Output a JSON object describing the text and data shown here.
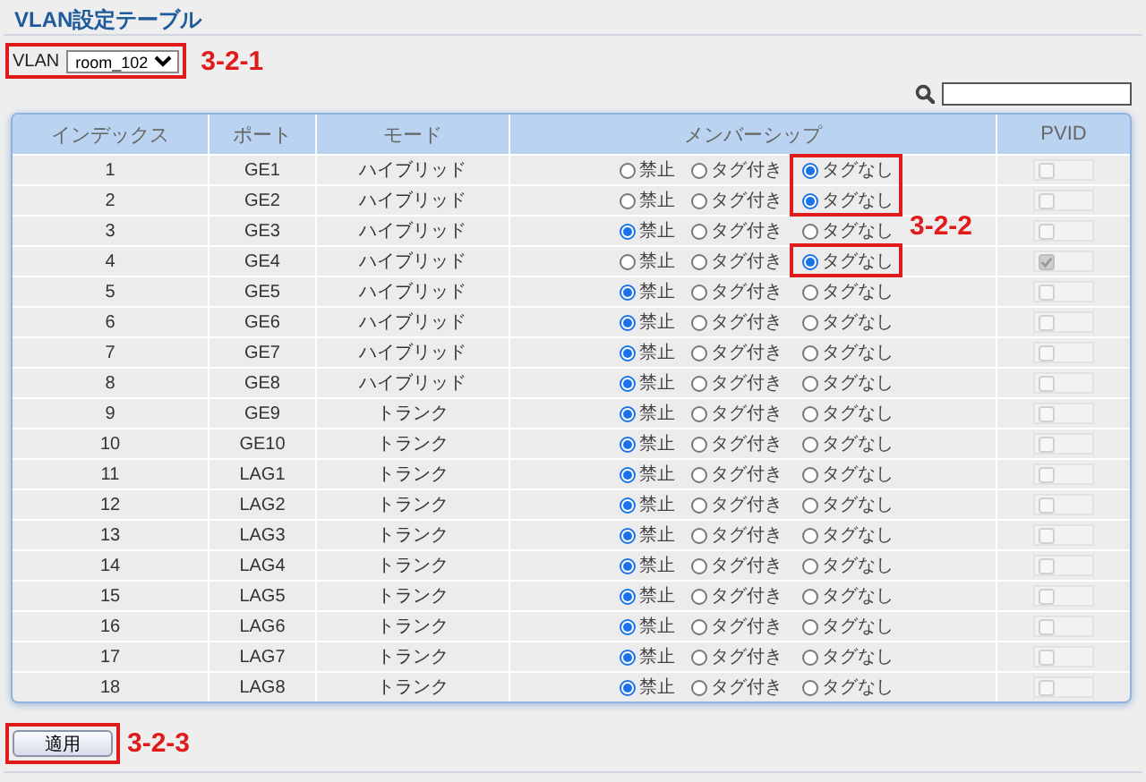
{
  "title": "VLAN設定テーブル",
  "vlan_selector": {
    "label": "VLAN",
    "value": "room_102"
  },
  "table": {
    "columns": [
      "インデックス",
      "ポート",
      "モード",
      "メンバーシップ",
      "PVID"
    ],
    "rows": [
      {
        "index": "1",
        "port": "GE1",
        "mode": "ハイブリッド",
        "membership": [
          {
            "label": "禁止",
            "selected": false
          },
          {
            "label": "タグ付き",
            "selected": false
          },
          {
            "label": "タグなし",
            "selected": true
          }
        ],
        "pvid_checked": false
      },
      {
        "index": "2",
        "port": "GE2",
        "mode": "ハイブリッド",
        "membership": [
          {
            "label": "禁止",
            "selected": false
          },
          {
            "label": "タグ付き",
            "selected": false
          },
          {
            "label": "タグなし",
            "selected": true
          }
        ],
        "pvid_checked": false
      },
      {
        "index": "3",
        "port": "GE3",
        "mode": "ハイブリッド",
        "membership": [
          {
            "label": "禁止",
            "selected": true
          },
          {
            "label": "タグ付き",
            "selected": false
          },
          {
            "label": "タグなし",
            "selected": false
          }
        ],
        "pvid_checked": false
      },
      {
        "index": "4",
        "port": "GE4",
        "mode": "ハイブリッド",
        "membership": [
          {
            "label": "禁止",
            "selected": false
          },
          {
            "label": "タグ付き",
            "selected": false
          },
          {
            "label": "タグなし",
            "selected": true
          }
        ],
        "pvid_checked": true
      },
      {
        "index": "5",
        "port": "GE5",
        "mode": "ハイブリッド",
        "membership": [
          {
            "label": "禁止",
            "selected": true
          },
          {
            "label": "タグ付き",
            "selected": false
          },
          {
            "label": "タグなし",
            "selected": false
          }
        ],
        "pvid_checked": false
      },
      {
        "index": "6",
        "port": "GE6",
        "mode": "ハイブリッド",
        "membership": [
          {
            "label": "禁止",
            "selected": true
          },
          {
            "label": "タグ付き",
            "selected": false
          },
          {
            "label": "タグなし",
            "selected": false
          }
        ],
        "pvid_checked": false
      },
      {
        "index": "7",
        "port": "GE7",
        "mode": "ハイブリッド",
        "membership": [
          {
            "label": "禁止",
            "selected": true
          },
          {
            "label": "タグ付き",
            "selected": false
          },
          {
            "label": "タグなし",
            "selected": false
          }
        ],
        "pvid_checked": false
      },
      {
        "index": "8",
        "port": "GE8",
        "mode": "ハイブリッド",
        "membership": [
          {
            "label": "禁止",
            "selected": true
          },
          {
            "label": "タグ付き",
            "selected": false
          },
          {
            "label": "タグなし",
            "selected": false
          }
        ],
        "pvid_checked": false
      },
      {
        "index": "9",
        "port": "GE9",
        "mode": "トランク",
        "membership": [
          {
            "label": "禁止",
            "selected": true
          },
          {
            "label": "タグ付き",
            "selected": false
          },
          {
            "label": "タグなし",
            "selected": false
          }
        ],
        "pvid_checked": false
      },
      {
        "index": "10",
        "port": "GE10",
        "mode": "トランク",
        "membership": [
          {
            "label": "禁止",
            "selected": true
          },
          {
            "label": "タグ付き",
            "selected": false
          },
          {
            "label": "タグなし",
            "selected": false
          }
        ],
        "pvid_checked": false
      },
      {
        "index": "11",
        "port": "LAG1",
        "mode": "トランク",
        "membership": [
          {
            "label": "禁止",
            "selected": true
          },
          {
            "label": "タグ付き",
            "selected": false
          },
          {
            "label": "タグなし",
            "selected": false
          }
        ],
        "pvid_checked": false
      },
      {
        "index": "12",
        "port": "LAG2",
        "mode": "トランク",
        "membership": [
          {
            "label": "禁止",
            "selected": true
          },
          {
            "label": "タグ付き",
            "selected": false
          },
          {
            "label": "タグなし",
            "selected": false
          }
        ],
        "pvid_checked": false
      },
      {
        "index": "13",
        "port": "LAG3",
        "mode": "トランク",
        "membership": [
          {
            "label": "禁止",
            "selected": true
          },
          {
            "label": "タグ付き",
            "selected": false
          },
          {
            "label": "タグなし",
            "selected": false
          }
        ],
        "pvid_checked": false
      },
      {
        "index": "14",
        "port": "LAG4",
        "mode": "トランク",
        "membership": [
          {
            "label": "禁止",
            "selected": true
          },
          {
            "label": "タグ付き",
            "selected": false
          },
          {
            "label": "タグなし",
            "selected": false
          }
        ],
        "pvid_checked": false
      },
      {
        "index": "15",
        "port": "LAG5",
        "mode": "トランク",
        "membership": [
          {
            "label": "禁止",
            "selected": true
          },
          {
            "label": "タグ付き",
            "selected": false
          },
          {
            "label": "タグなし",
            "selected": false
          }
        ],
        "pvid_checked": false
      },
      {
        "index": "16",
        "port": "LAG6",
        "mode": "トランク",
        "membership": [
          {
            "label": "禁止",
            "selected": true
          },
          {
            "label": "タグ付き",
            "selected": false
          },
          {
            "label": "タグなし",
            "selected": false
          }
        ],
        "pvid_checked": false
      },
      {
        "index": "17",
        "port": "LAG7",
        "mode": "トランク",
        "membership": [
          {
            "label": "禁止",
            "selected": true
          },
          {
            "label": "タグ付き",
            "selected": false
          },
          {
            "label": "タグなし",
            "selected": false
          }
        ],
        "pvid_checked": false
      },
      {
        "index": "18",
        "port": "LAG8",
        "mode": "トランク",
        "membership": [
          {
            "label": "禁止",
            "selected": true
          },
          {
            "label": "タグ付き",
            "selected": false
          },
          {
            "label": "タグなし",
            "selected": false
          }
        ],
        "pvid_checked": false
      }
    ]
  },
  "apply_button": "適用",
  "annotations": [
    {
      "label": "3-2-1"
    },
    {
      "label": "3-2-2"
    },
    {
      "label": "3-2-3"
    }
  ]
}
